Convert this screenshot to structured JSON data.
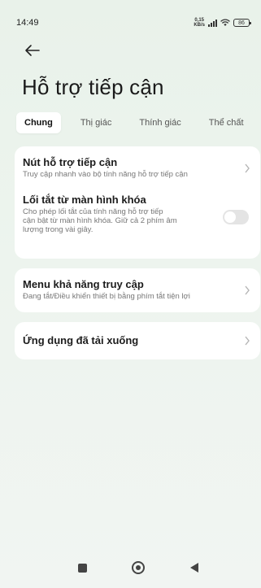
{
  "status": {
    "time": "14:49",
    "speed_value": "0,15",
    "speed_unit": "KB/s",
    "battery": "86"
  },
  "page": {
    "title": "Hỗ trợ tiếp cận"
  },
  "tabs": [
    {
      "label": "Chung",
      "active": true
    },
    {
      "label": "Thị giác",
      "active": false
    },
    {
      "label": "Thính giác",
      "active": false
    },
    {
      "label": "Thể chất",
      "active": false
    }
  ],
  "settings": {
    "shortcut_button": {
      "title": "Nút hỗ trợ tiếp cận",
      "subtitle": "Truy cập nhanh vào bộ tính năng hỗ trợ tiếp cận"
    },
    "lock_screen_shortcut": {
      "title": "Lối tắt từ màn hình khóa",
      "subtitle_line1": "Cho phép lối tắt của tính năng hỗ trợ tiếp",
      "subtitle_line2": "cận bật từ màn hình khóa. Giữ cả 2 phím âm",
      "subtitle_line3": "lượng trong vài giây.",
      "enabled": false
    },
    "accessibility_menu": {
      "title": "Menu khả năng truy cập",
      "subtitle": "Đang tắt/Điều khiển thiết bị bằng phím tắt tiện lợi"
    },
    "downloaded_apps": {
      "title": "Ứng dụng đã tải xuống"
    }
  },
  "icons": {
    "back": "arrow-left-icon",
    "chevron": "chevron-right-icon",
    "nav_recents": "square-icon",
    "nav_home": "circle-icon",
    "nav_back": "triangle-left-icon"
  }
}
